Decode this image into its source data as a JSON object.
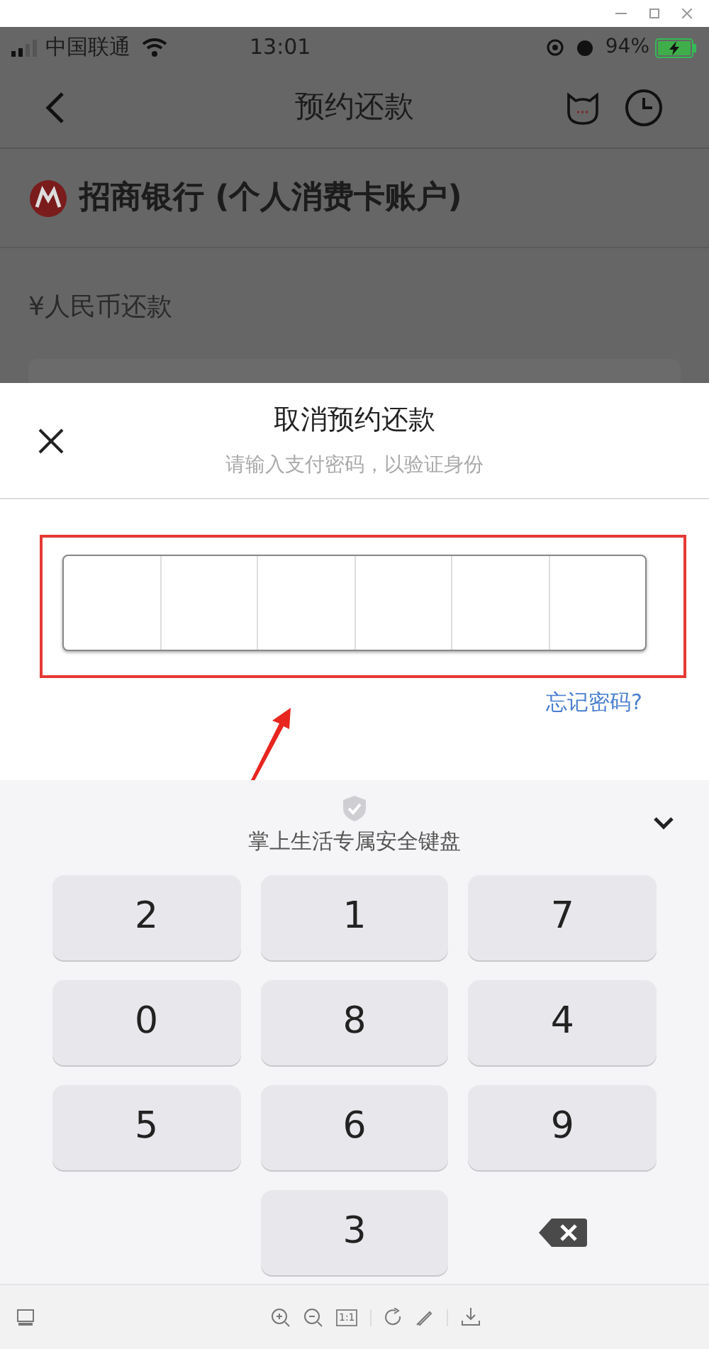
{
  "status_bar": {
    "carrier": "中国联通",
    "time": "13:01",
    "battery": "94%"
  },
  "nav": {
    "title": "预约还款"
  },
  "bank": {
    "name": "招商银行 (个人消费卡账户)"
  },
  "currency": {
    "label": "¥人民币还款"
  },
  "sheet": {
    "title": "取消预约还款",
    "subtitle": "请输入支付密码，以验证身份",
    "forgot_link": "忘记密码?"
  },
  "keyboard": {
    "title": "掌上生活专属安全键盘",
    "keys": [
      {
        "kind": "digit",
        "label": "2"
      },
      {
        "kind": "digit",
        "label": "1"
      },
      {
        "kind": "digit",
        "label": "7"
      },
      {
        "kind": "digit",
        "label": "0"
      },
      {
        "kind": "digit",
        "label": "8"
      },
      {
        "kind": "digit",
        "label": "4"
      },
      {
        "kind": "digit",
        "label": "5"
      },
      {
        "kind": "digit",
        "label": "6"
      },
      {
        "kind": "digit",
        "label": "9"
      },
      {
        "kind": "blank"
      },
      {
        "kind": "digit",
        "label": "3"
      },
      {
        "kind": "delete"
      }
    ]
  },
  "viewer_toolbar": {
    "actual_size": "1:1"
  }
}
